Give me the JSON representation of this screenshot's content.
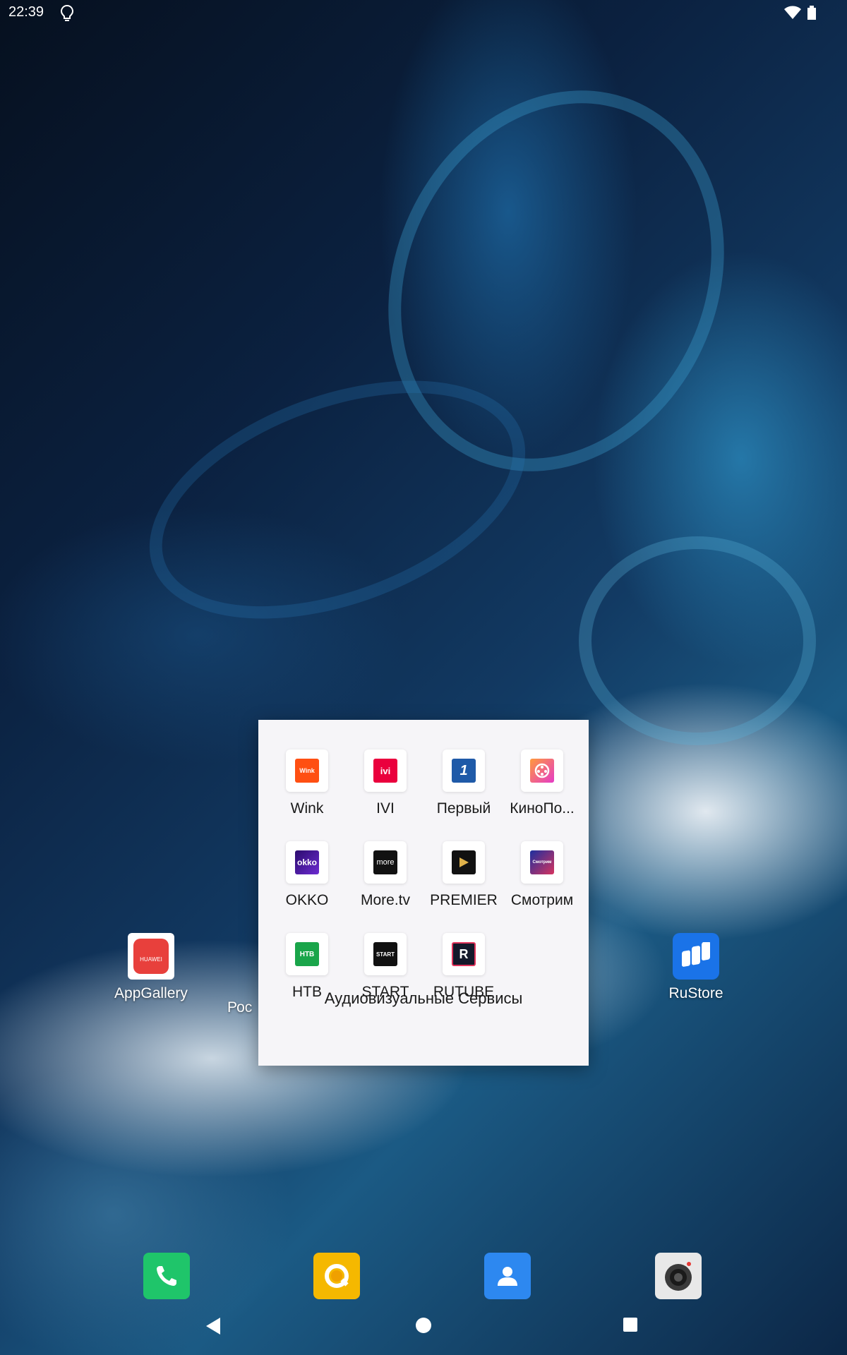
{
  "status_bar": {
    "time": "22:39",
    "icons": [
      "lightbulb-icon",
      "wifi-icon",
      "battery-icon"
    ]
  },
  "home": {
    "apps": [
      {
        "label": "AppGallery",
        "icon": "appgallery-icon",
        "icon_text": "HUAWEI",
        "color": "#e8403c"
      },
      {
        "label": "Рос",
        "icon": "partially-hidden-app-icon"
      },
      {
        "label": "RuStore",
        "icon": "rustore-icon",
        "color": "#1a73e8"
      }
    ]
  },
  "folder": {
    "name": "Аудиовизуальные Сервисы",
    "apps": [
      {
        "label": "Wink",
        "icon": "wink-icon",
        "icon_text": "Wink",
        "color": "#ff4f12"
      },
      {
        "label": "IVI",
        "icon": "ivi-icon",
        "icon_text": "ivi",
        "color": "#ea003d"
      },
      {
        "label": "Первый",
        "icon": "perviy-icon",
        "icon_text": "1",
        "color": "#1f5aa8"
      },
      {
        "label": "КиноПо...",
        "icon": "kinopoisk-icon",
        "color": "#ff6b3d"
      },
      {
        "label": "OKKO",
        "icon": "okko-icon",
        "icon_text": "okko",
        "color": "#4a1a8c"
      },
      {
        "label": "More.tv",
        "icon": "moretv-icon",
        "icon_text": "more",
        "color": "#111111"
      },
      {
        "label": "PREMIER",
        "icon": "premier-icon",
        "color": "#111111"
      },
      {
        "label": "Смотрим",
        "icon": "smotrim-icon",
        "icon_text": "Смотрим",
        "color": "#2c3da8"
      },
      {
        "label": "НТВ",
        "icon": "ntv-icon",
        "icon_text": "НТВ",
        "color": "#1aa54a"
      },
      {
        "label": "START",
        "icon": "start-icon",
        "icon_text": "START",
        "color": "#111111"
      },
      {
        "label": "RUTUBE",
        "icon": "rutube-icon",
        "icon_text": "R",
        "color": "#14182a"
      }
    ]
  },
  "dock": [
    {
      "icon": "phone-icon"
    },
    {
      "icon": "browser-icon"
    },
    {
      "icon": "contacts-icon"
    },
    {
      "icon": "camera-icon"
    }
  ],
  "nav": [
    "back-icon",
    "home-icon",
    "recents-icon"
  ]
}
